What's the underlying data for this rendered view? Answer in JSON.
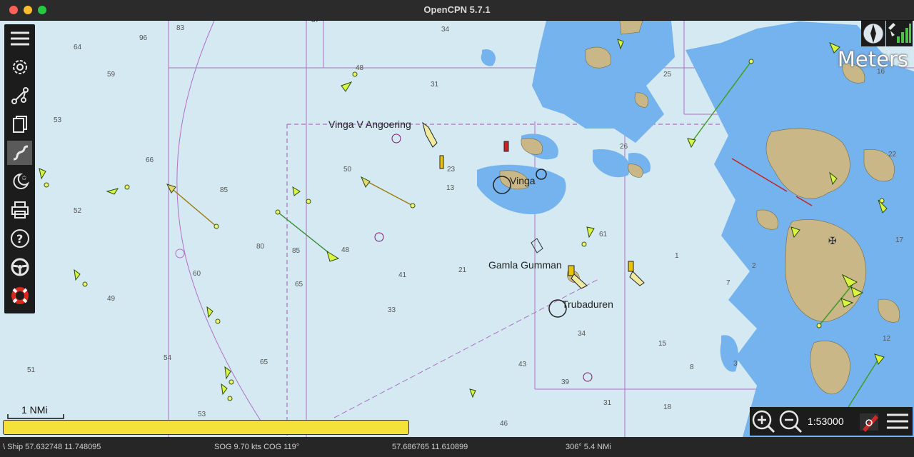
{
  "window": {
    "title": "OpenCPN 5.7.1"
  },
  "toolbar": {
    "items": [
      {
        "icon": "hamburger-menu-icon"
      },
      {
        "icon": "gear-icon"
      },
      {
        "icon": "route-icon"
      },
      {
        "icon": "documents-icon"
      },
      {
        "icon": "track-icon",
        "active": true
      },
      {
        "icon": "night-mode-icon"
      },
      {
        "icon": "print-icon"
      },
      {
        "icon": "help-icon"
      },
      {
        "icon": "steering-wheel-icon"
      },
      {
        "icon": "lifebuoy-icon"
      }
    ]
  },
  "chart": {
    "units_label": "Meters",
    "place_labels": [
      "Vinga V Angoering",
      "Vinga",
      "Gamla Gumman",
      "Trubaduren"
    ],
    "depths": [
      "83",
      "37",
      "34",
      "96",
      "64",
      "59",
      "53",
      "66",
      "85",
      "52",
      "80",
      "85",
      "60",
      "49",
      "54",
      "51",
      "53",
      "65",
      "65",
      "41",
      "33",
      "43",
      "39",
      "31",
      "46",
      "18",
      "15",
      "8",
      "3",
      "34",
      "48",
      "31",
      "50",
      "48",
      "13",
      "21",
      "23",
      "26",
      "25",
      "16",
      "22",
      "17",
      "12",
      "61",
      "2",
      "7",
      "1"
    ],
    "scale_bar_label": "1 NMi"
  },
  "zoom": {
    "scale": "1:53000"
  },
  "progress": {
    "fraction": 1.0
  },
  "status": {
    "ship": "\\ Ship 57.632748   11.748095",
    "sog_cog": "SOG 9.70 kts   COG 119°",
    "cursor": "57.686765   11.610899",
    "bearing": "306°   5.4 NMi"
  },
  "colors": {
    "sea": "#d4e9f1",
    "shallow": "#75b3ee",
    "land": "#c9b787",
    "route": "#b23bc0",
    "progress": "#f4e23a"
  }
}
